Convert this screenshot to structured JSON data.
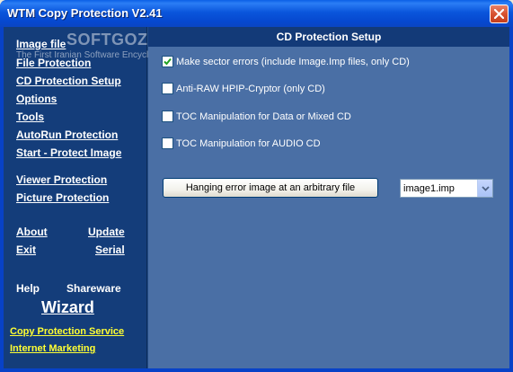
{
  "window": {
    "title": "WTM Copy Protection V2.41"
  },
  "watermark": {
    "logo": "SOFTGOZAR.COM",
    "subtitle": "The First Iranian Software Encyclopedia"
  },
  "nav": {
    "items": [
      {
        "label": "Image file"
      },
      {
        "label": "File Protection"
      },
      {
        "label": "CD Protection Setup"
      },
      {
        "label": "Options"
      },
      {
        "label": "Tools"
      },
      {
        "label": "AutoRun Protection"
      },
      {
        "label": "Start - Protect Image"
      },
      {
        "label": "Viewer Protection"
      },
      {
        "label": "Picture Protection"
      }
    ],
    "about": "About",
    "update": "Update",
    "exit": "Exit",
    "serial": "Serial",
    "help": "Help",
    "shareware": "Shareware",
    "wizard": "Wizard",
    "copy_service": "Copy Protection Service",
    "internet_marketing": "Internet Marketing"
  },
  "main": {
    "header": "CD Protection Setup",
    "options": [
      {
        "label": "Make sector errors (include Image.Imp files, only CD)",
        "checked": true
      },
      {
        "label": "Anti-RAW HPIP-Cryptor (only CD)",
        "checked": false
      },
      {
        "label": "TOC Manipulation for Data or Mixed CD",
        "checked": false
      },
      {
        "label": "TOC Manipulation for AUDIO CD",
        "checked": false
      }
    ],
    "hanging_button": "Hanging error image at an arbitrary file",
    "image_select": "image1.imp"
  },
  "colors": {
    "titlebar": "#0A56DC",
    "nav_bg": "#143D7A",
    "panel_bg": "#4A6FA5",
    "link_yellow": "#FFFF33",
    "close_btn": "#D7512F"
  },
  "icons": {
    "close": "close-icon",
    "check": "checkmark-icon",
    "dropdown": "chevron-down-icon"
  }
}
